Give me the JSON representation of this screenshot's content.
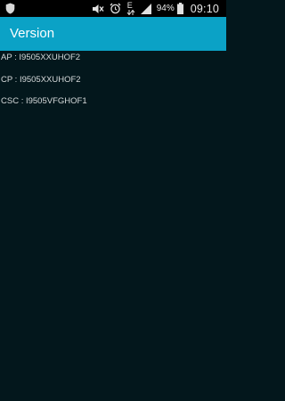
{
  "status_bar": {
    "battery_percent": "94%",
    "time": "09:10",
    "network_type": "E"
  },
  "app_bar": {
    "title": "Version"
  },
  "versions": [
    {
      "label": "AP",
      "value": "I9505XXUHOF2",
      "text": "AP : I9505XXUHOF2"
    },
    {
      "label": "CP",
      "value": "I9505XXUHOF2",
      "text": "CP : I9505XXUHOF2"
    },
    {
      "label": "CSC",
      "value": "I9505VFGHOF1",
      "text": "CSC : I9505VFGHOF1"
    }
  ]
}
